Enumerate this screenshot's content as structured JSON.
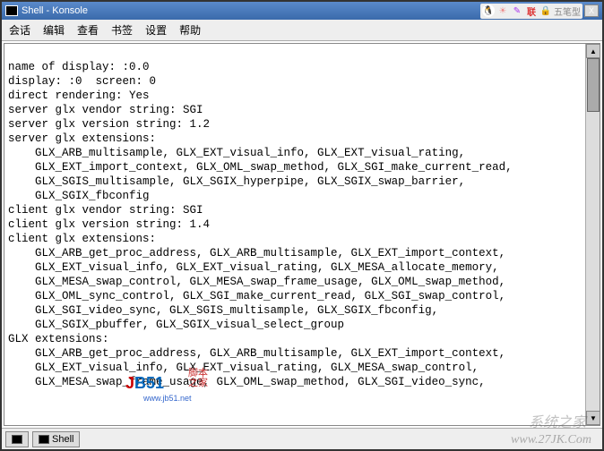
{
  "titlebar": {
    "text": "Shell - Konsole",
    "tray_lian": "联",
    "tray_ime": "五笔型",
    "btn_x": "X"
  },
  "menubar": {
    "items": [
      "会话",
      "编辑",
      "查看",
      "书签",
      "设置",
      "帮助"
    ]
  },
  "terminal": {
    "lines": [
      "",
      "name of display: :0.0",
      "display: :0  screen: 0",
      "direct rendering: Yes",
      "server glx vendor string: SGI",
      "server glx version string: 1.2",
      "server glx extensions:",
      "    GLX_ARB_multisample, GLX_EXT_visual_info, GLX_EXT_visual_rating,",
      "    GLX_EXT_import_context, GLX_OML_swap_method, GLX_SGI_make_current_read,",
      "    GLX_SGIS_multisample, GLX_SGIX_hyperpipe, GLX_SGIX_swap_barrier,",
      "    GLX_SGIX_fbconfig",
      "client glx vendor string: SGI",
      "client glx version string: 1.4",
      "client glx extensions:",
      "    GLX_ARB_get_proc_address, GLX_ARB_multisample, GLX_EXT_import_context,",
      "    GLX_EXT_visual_info, GLX_EXT_visual_rating, GLX_MESA_allocate_memory,",
      "    GLX_MESA_swap_control, GLX_MESA_swap_frame_usage, GLX_OML_swap_method,",
      "    GLX_OML_sync_control, GLX_SGI_make_current_read, GLX_SGI_swap_control,",
      "    GLX_SGI_video_sync, GLX_SGIS_multisample, GLX_SGIX_fbconfig,",
      "    GLX_SGIX_pbuffer, GLX_SGIX_visual_select_group",
      "GLX extensions:",
      "    GLX_ARB_get_proc_address, GLX_ARB_multisample, GLX_EXT_import_context,",
      "    GLX_EXT_visual_info, GLX_EXT_visual_rating, GLX_MESA_swap_control,",
      "    GLX_MESA_swap_frame_usage, GLX_OML_swap_method, GLX_SGI_video_sync,"
    ]
  },
  "statusbar": {
    "tab_label": "Shell"
  },
  "watermark": {
    "jb51_j": "J",
    "jb51_rest": "B51",
    "script_l1": "脚本",
    "script_l2": "之家",
    "url": "www.jb51.net",
    "sys": "系统之家",
    "jk": "www.27JK.Com"
  }
}
